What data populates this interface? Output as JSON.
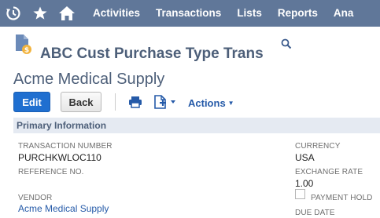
{
  "nav": {
    "icons": [
      "recent-records-icon",
      "star-icon",
      "home-icon"
    ],
    "items": [
      "Activities",
      "Transactions",
      "Lists",
      "Reports",
      "Ana"
    ]
  },
  "header": {
    "record_type": "ABC Cust Purchase Type Trans",
    "record_name": "Acme Medical Supply"
  },
  "toolbar": {
    "edit_label": "Edit",
    "back_label": "Back",
    "actions_label": "Actions"
  },
  "section": {
    "title": "Primary Information"
  },
  "fields": {
    "transaction_number": {
      "label": "TRANSACTION NUMBER",
      "value": "PURCHKWLOC110"
    },
    "reference_no": {
      "label": "REFERENCE NO.",
      "value": ""
    },
    "vendor": {
      "label": "VENDOR",
      "value": "Acme Medical Supply"
    },
    "currency": {
      "label": "CURRENCY",
      "value": "USA"
    },
    "exchange_rate": {
      "label": "EXCHANGE RATE",
      "value": "1.00"
    },
    "payment_hold": {
      "label": "PAYMENT HOLD",
      "checked": false
    },
    "due_date": {
      "label": "DUE DATE",
      "value": ""
    }
  },
  "colors": {
    "nav_bg": "#607799",
    "primary_button": "#1f6fd0",
    "link": "#255aa8",
    "heading": "#4d5f79"
  }
}
